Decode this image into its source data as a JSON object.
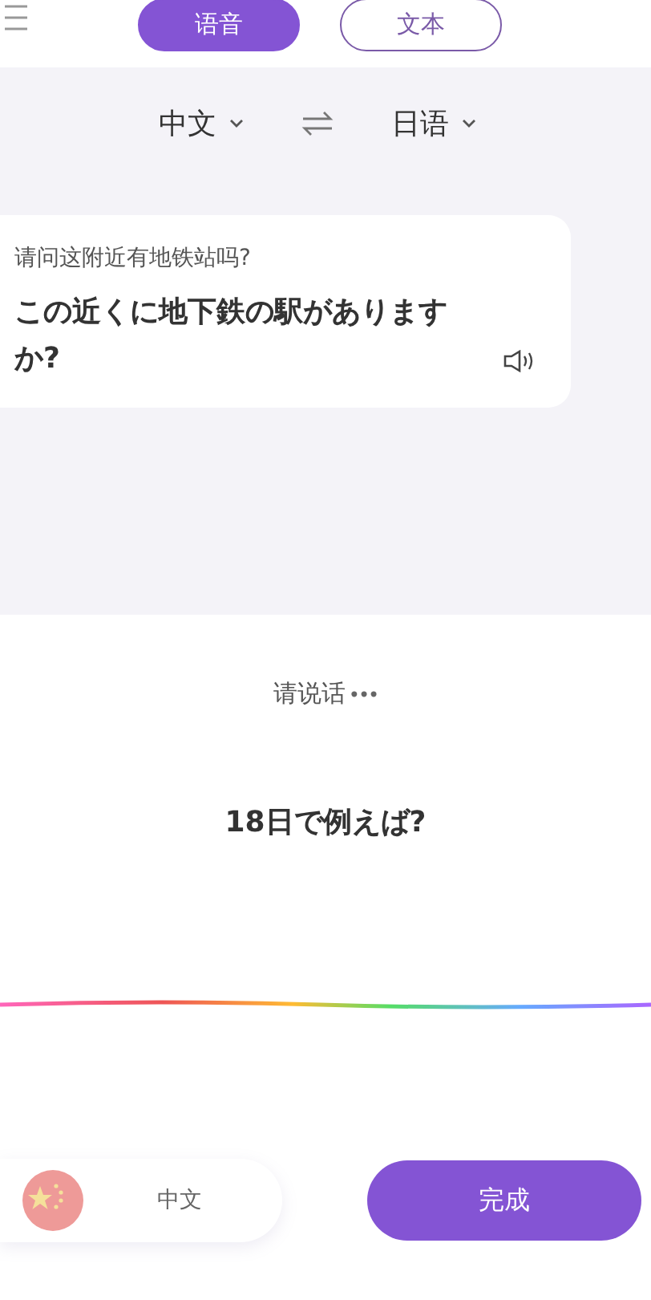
{
  "tabs": [
    {
      "label": "语音",
      "selected": true
    },
    {
      "label": "文本",
      "selected": false
    }
  ],
  "languages": {
    "source": "中文",
    "target": "日语"
  },
  "result": {
    "source_text": "请问这附近有地铁站吗?",
    "translation": "この近くに地下鉄の駅がありますか?"
  },
  "listening": {
    "prompt": "请说话",
    "dots": "•••",
    "recognized": "18日で例えば?"
  },
  "bottom_bar": {
    "language": "中文",
    "button": "完成"
  }
}
